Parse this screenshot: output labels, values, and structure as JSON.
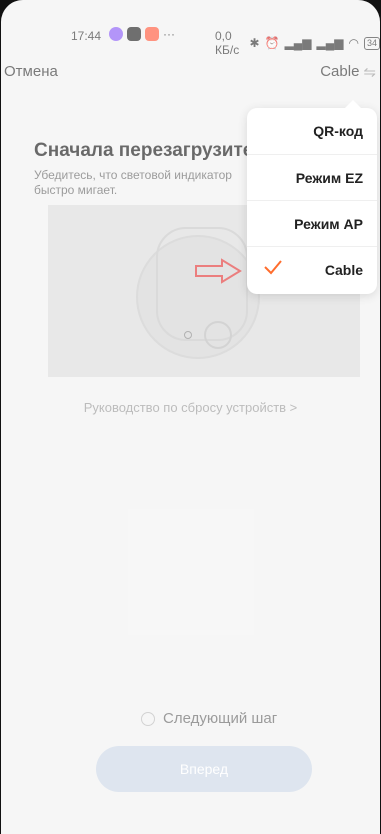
{
  "status_bar": {
    "time": "17:44",
    "speed": "0,0 КБ/с",
    "battery": "34"
  },
  "top_bar": {
    "cancel_label": "Отмена",
    "mode_label": "Cable",
    "mode_icon": "swap-arrows-icon"
  },
  "main": {
    "title": "Сначала перезагрузите",
    "subtitle": "Убедитесь, что световой индикатор быстро мигает.",
    "guide_link": "Руководство по сбросу устройств >",
    "next_step_label": "Следующий шаг",
    "forward_button": "Вперед"
  },
  "menu": {
    "items": [
      {
        "label": "QR-код",
        "selected": false
      },
      {
        "label": "Режим EZ",
        "selected": false
      },
      {
        "label": "Режим AP",
        "selected": false
      },
      {
        "label": "Cable",
        "selected": true
      }
    ]
  },
  "colors": {
    "accent": "#ff6d2d",
    "arrow": "#e03a3a"
  }
}
